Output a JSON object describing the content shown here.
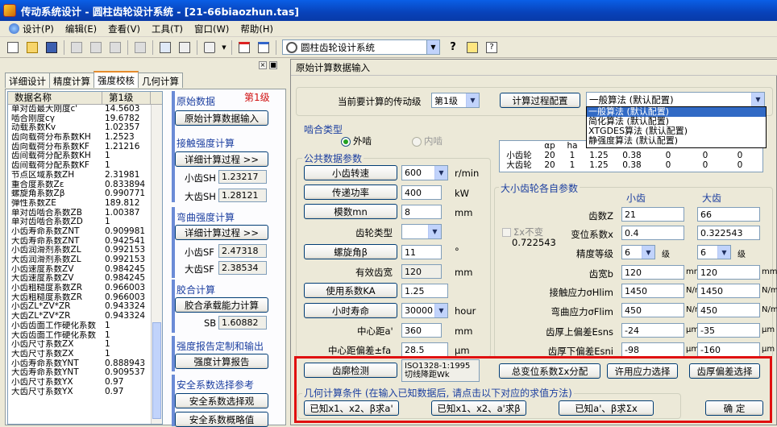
{
  "window": {
    "title": "传动系统设计 - 圆柱齿轮设计系统 - [21-66biaozhun.tas]"
  },
  "menu": [
    "设计(P)",
    "编辑(E)",
    "查看(V)",
    "工具(T)",
    "窗口(W)",
    "帮助(H)"
  ],
  "toolbar": {
    "system_select": "圆柱齿轮设计系统"
  },
  "left": {
    "tabs": [
      "详细设计",
      "精度计算",
      "强度校核",
      "几何计算"
    ],
    "active_tab": 2,
    "grid_headers": [
      "数据名称",
      "第1级"
    ],
    "rows": [
      [
        "单对齿最大刚度c'",
        "14.5603"
      ],
      [
        "啮合刚度cγ",
        "19.6782"
      ],
      [
        "动载系数Kv",
        "1.02357"
      ],
      [
        "齿向载荷分布系数KH",
        "1.2523"
      ],
      [
        "齿向载荷分布系数KF",
        "1.21216"
      ],
      [
        "齿间载荷分配系数KH",
        "1"
      ],
      [
        "齿间载荷分配系数KF",
        "1"
      ],
      [
        "节点区域系数ZH",
        "2.31981"
      ],
      [
        "重合度系数Zε",
        "0.833894"
      ],
      [
        "螺旋角系数Zβ",
        "0.990771"
      ],
      [
        "弹性系数ZE",
        "189.812"
      ],
      [
        "单对齿啮合系数ZB",
        "1.00387"
      ],
      [
        "单对齿啮合系数ZD",
        "1"
      ],
      [
        "小齿寿命系数ZNT",
        "0.909981"
      ],
      [
        "大齿寿命系数ZNT",
        "0.942541"
      ],
      [
        "小齿润滑剂系数ZL",
        "0.992153"
      ],
      [
        "大齿润滑剂系数ZL",
        "0.992153"
      ],
      [
        "小齿速度系数ZV",
        "0.984245"
      ],
      [
        "大齿速度系数ZV",
        "0.984245"
      ],
      [
        "小齿粗糙度系数ZR",
        "0.966003"
      ],
      [
        "大齿粗糙度系数ZR",
        "0.966003"
      ],
      [
        "小齿ZL*ZV*ZR",
        "0.943324"
      ],
      [
        "大齿ZL*ZV*ZR",
        "0.943324"
      ],
      [
        "小齿齿面工作硬化系数",
        "1"
      ],
      [
        "大齿齿面工作硬化系数",
        "1"
      ],
      [
        "小齿尺寸系数ZX",
        "1"
      ],
      [
        "大齿尺寸系数ZX",
        "1"
      ],
      [
        "小齿寿命系数YNT",
        "0.888943"
      ],
      [
        "大齿寿命系数YNT",
        "0.909537"
      ],
      [
        "小齿尺寸系数YX",
        "0.97"
      ],
      [
        "大齿尺寸系数YX",
        "0.97"
      ]
    ],
    "side": {
      "orig_title": "原始数据",
      "level_label": "第1级",
      "orig_btn": "原始计算数据输入",
      "contact_title": "接触强度计算",
      "contact_btn": "详细计算过程  >>",
      "sh1_label": "小齿SH",
      "sh1": "1.23217",
      "sh2_label": "大齿SH",
      "sh2": "1.28121",
      "bend_title": "弯曲强度计算",
      "bend_btn": "详细计算过程  >>",
      "sf1_label": "小齿SF",
      "sf1": "2.47318",
      "sf2_label": "大齿SF",
      "sf2": "2.38534",
      "glue_title": "胶合计算",
      "glue_btn": "胶合承载能力计算",
      "sb_label": "SB",
      "sb": "1.60882",
      "report_title": "强度报告定制和输出",
      "report_btn": "强度计算报告",
      "safety_title": "安全系数选择参考",
      "safety_btn": "安全系数选择观",
      "safety_btn2": "安全系数概略值"
    }
  },
  "main": {
    "title": "原始计算数据输入",
    "stage_label": "当前要计算的传动级",
    "stage_value": "第1级",
    "config_btn": "计算过程配置",
    "algo_value": "一般算法 (默认配置)",
    "algo_options": [
      "一般算法 (默认配置)",
      "简化算法 (默认配置)",
      "XTGDES算法 (默认配置)",
      "静强度算法 (默认配置)"
    ],
    "mesh_title": "啮合类型",
    "external": "外啮",
    "internal": "内啮",
    "common_title": "公共数据参数",
    "speed_btn": "小齿转速",
    "speed": "600",
    "speed_unit": "r/min",
    "power_btn": "传递功率",
    "power": "400",
    "power_unit": "kW",
    "module_btn": "模数mn",
    "module": "8",
    "module_unit": "mm",
    "tooth_type_label": "齿轮类型",
    "helix_btn": "螺旋角β",
    "helix": "11",
    "helix_unit": "°",
    "width_label": "有效齿宽",
    "width": "120",
    "width_unit": "mm",
    "ka_btn": "使用系数KA",
    "ka": "1.25",
    "life_btn": "小时寿命",
    "life": "30000",
    "life_unit": "hour",
    "center_label": "中心距a'",
    "center": "360",
    "center_unit": "mm",
    "center_dev_label": "中心距偏差±fa",
    "center_dev": "28.5",
    "center_dev_unit": "μm",
    "ratio_table": {
      "headers": [
        "",
        "αp",
        "ha",
        "",
        "",
        "",
        "",
        ""
      ],
      "rows": [
        [
          "小齿轮",
          "20",
          "1",
          "1.25",
          "0.38",
          "0",
          "0",
          "0"
        ],
        [
          "大齿轮",
          "20",
          "1",
          "1.25",
          "0.38",
          "0",
          "0",
          "0"
        ]
      ]
    },
    "gear_title": "大小齿轮各自参数",
    "small_title": "小齿",
    "big_title": "大齿",
    "sum_x_label": "Σx不变",
    "sum_x_value": "0.722543",
    "params": [
      {
        "label": "齿数Z",
        "small": "21",
        "big": "66",
        "unit": ""
      },
      {
        "label": "变位系数x",
        "small": "0.4",
        "big": "0.322543",
        "unit": ""
      },
      {
        "label": "精度等级",
        "small": "6",
        "big": "6",
        "unit": "级"
      },
      {
        "label": "齿宽b",
        "small": "120",
        "big": "120",
        "unit": "mm"
      },
      {
        "label": "接触应力σHlim",
        "small": "1450",
        "big": "1450",
        "unit": "N/mm²"
      },
      {
        "label": "弯曲应力σFlim",
        "small": "450",
        "big": "450",
        "unit": "N/mm²"
      },
      {
        "label": "齿厚上偏差Esns",
        "small": "-24",
        "big": "-35",
        "unit": "μm"
      },
      {
        "label": "齿厚下偏差Esni",
        "small": "-98",
        "big": "-160",
        "unit": "μm"
      }
    ],
    "tooth_check_btn": "齿廓检测",
    "tooth_check_text": [
      "ISO1328-1:1995",
      "切线降距Wk"
    ],
    "total_shift_btn": "总变位系数Σx分配",
    "allow_stress_btn": "许用应力选择",
    "thickness_dev_btn": "齿厚偏差选择",
    "geom_title": "几何计算条件 (在输入已知数据后, 请点击以下对应的求值方法)",
    "geom_btn1": "已知x1、x2、β求a'",
    "geom_btn2": "已知x1、x2、a'求β",
    "geom_btn3": "已知a'、β求Σx",
    "ok_btn": "确  定"
  }
}
